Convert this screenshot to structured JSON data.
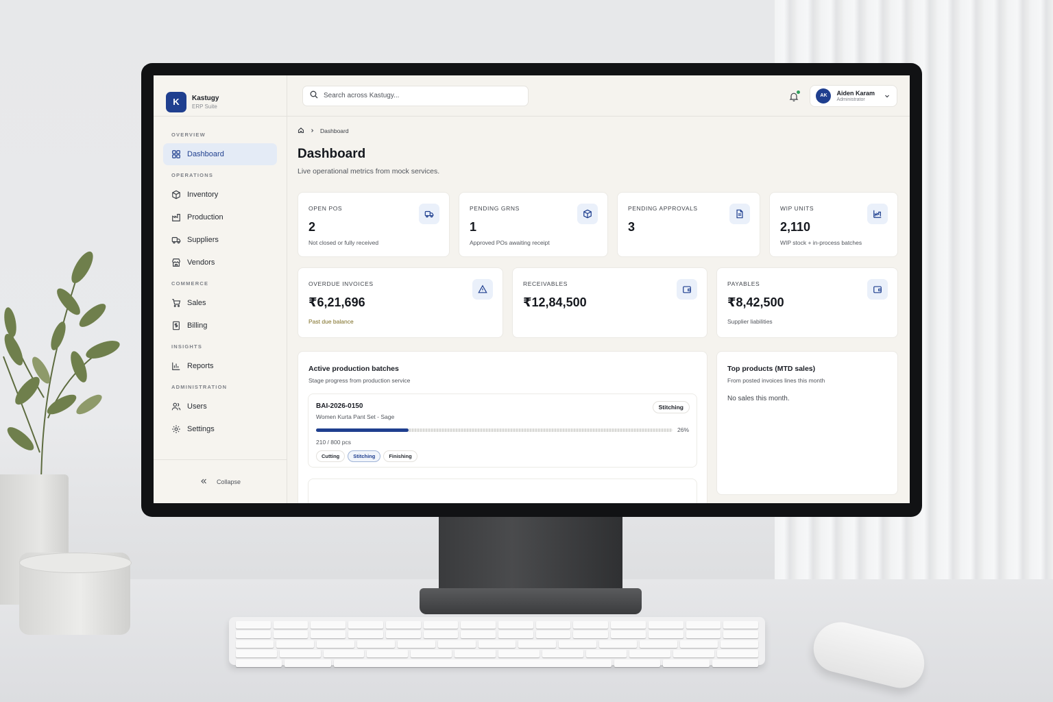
{
  "brand": {
    "name": "Kastugy",
    "subtitle": "ERP Suite",
    "logo_letter": "K"
  },
  "sidebar": {
    "sections": [
      {
        "title": "OVERVIEW",
        "items": [
          {
            "label": "Dashboard",
            "icon": "grid-icon",
            "active": true
          }
        ]
      },
      {
        "title": "OPERATIONS",
        "items": [
          {
            "label": "Inventory",
            "icon": "box-icon"
          },
          {
            "label": "Production",
            "icon": "factory-icon"
          },
          {
            "label": "Suppliers",
            "icon": "truck-icon"
          },
          {
            "label": "Vendors",
            "icon": "store-icon"
          }
        ]
      },
      {
        "title": "COMMERCE",
        "items": [
          {
            "label": "Sales",
            "icon": "cart-icon"
          },
          {
            "label": "Billing",
            "icon": "receipt-icon"
          }
        ]
      },
      {
        "title": "INSIGHTS",
        "items": [
          {
            "label": "Reports",
            "icon": "bar-chart-icon"
          }
        ]
      },
      {
        "title": "ADMINISTRATION",
        "items": [
          {
            "label": "Users",
            "icon": "users-icon"
          },
          {
            "label": "Settings",
            "icon": "gear-icon"
          }
        ]
      }
    ],
    "collapse_label": "Collapse"
  },
  "search": {
    "placeholder": "Search across Kastugy..."
  },
  "user": {
    "initials": "AK",
    "name": "Aiden Karam",
    "role": "Administrator"
  },
  "breadcrumb": {
    "current": "Dashboard"
  },
  "page": {
    "title": "Dashboard",
    "subtitle": "Live operational metrics from mock services."
  },
  "kpis_row1": [
    {
      "label": "OPEN POS",
      "value": "2",
      "note": "Not closed or fully received",
      "icon": "truck-icon"
    },
    {
      "label": "PENDING GRNS",
      "value": "1",
      "note": "Approved POs awaiting receipt",
      "icon": "box-icon"
    },
    {
      "label": "PENDING APPROVALS",
      "value": "3",
      "note": "",
      "icon": "document-icon"
    },
    {
      "label": "WIP UNITS",
      "value": "2,110",
      "note": "WIP stock + in-process batches",
      "icon": "factory-icon"
    }
  ],
  "kpis_row2": [
    {
      "label": "OVERDUE INVOICES",
      "value": "₹6,21,696",
      "note": "Past due balance",
      "icon": "alert-triangle-icon"
    },
    {
      "label": "RECEIVABLES",
      "value": "₹12,84,500",
      "note": "",
      "icon": "wallet-icon"
    },
    {
      "label": "PAYABLES",
      "value": "₹8,42,500",
      "note": "Supplier liabilities",
      "icon": "wallet-icon"
    }
  ],
  "colors": {
    "accent": "#1f3f8f",
    "overdue_note": "#7a6a1f",
    "status_dot": "#2f9e5b"
  },
  "production": {
    "title": "Active production batches",
    "subtitle": "Stage progress from production service",
    "batches": [
      {
        "id": "BAI-2026-0150",
        "product": "Women Kurta Pant Set - Sage",
        "stage": "Stitching",
        "progress": 0.26,
        "progress_label": "26%",
        "quantity": "210 / 800 pcs",
        "stages": [
          "Cutting",
          "Stitching",
          "Finishing"
        ],
        "current_stage_index": 1
      }
    ]
  },
  "top_products": {
    "title": "Top products (MTD sales)",
    "subtitle": "From posted invoices lines this month",
    "empty": "No sales this month."
  }
}
